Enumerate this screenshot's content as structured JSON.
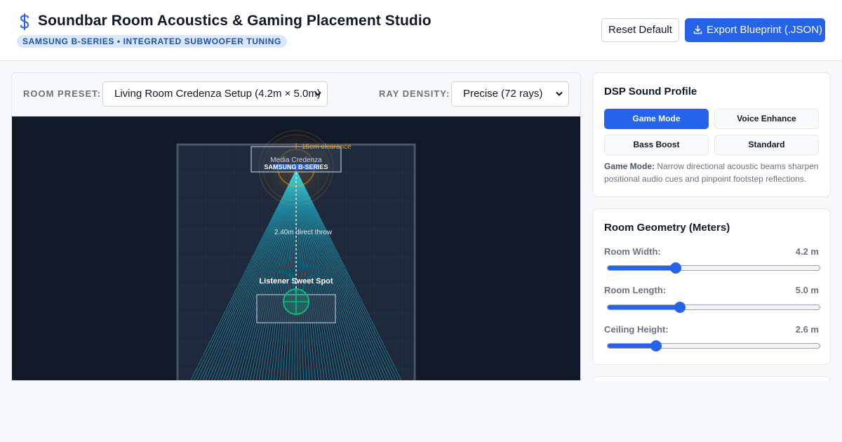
{
  "header": {
    "title": "Soundbar Room Acoustics & Gaming Placement Studio",
    "subtitle": "SAMSUNG B-SERIES • INTEGRATED SUBWOOFER TUNING",
    "logo_icon": "dollar-sign-icon",
    "reset_label": "Reset Default",
    "export_label": "Export Blueprint (.JSON)",
    "export_icon": "download-icon"
  },
  "toolbar": {
    "room_preset_label": "ROOM PRESET:",
    "room_preset_value": "Living Room Credenza Setup (4.2m × 5.0m)",
    "ray_density_label": "RAY DENSITY:",
    "ray_density_value": "Precise (72 rays)"
  },
  "canvas": {
    "clearance_label": "15cm clearance",
    "credenza_label": "Media Credenza",
    "soundbar_label": "SAMSUNG B-SERIES",
    "throw_label": "2.40m direct throw",
    "listener_label": "Listener Sweet Spot",
    "ray_count": 72,
    "colors": {
      "background": "#111827",
      "rays": "#22d3ee",
      "listener": "#10b981",
      "clearance": "#f59e0b",
      "soundbar": "#2563eb"
    }
  },
  "dsp": {
    "title": "DSP Sound Profile",
    "modes": [
      {
        "label": "Game Mode",
        "active": true
      },
      {
        "label": "Voice Enhance",
        "active": false
      },
      {
        "label": "Bass Boost",
        "active": false
      },
      {
        "label": "Standard",
        "active": false
      }
    ],
    "description_bold": "Game Mode:",
    "description_text": " Narrow directional acoustic beams sharpen positional audio cues and pinpoint footstep reflections."
  },
  "geometry": {
    "title": "Room Geometry (Meters)",
    "sliders": [
      {
        "label": "Room Width:",
        "value": "4.2 m",
        "fraction": 0.32
      },
      {
        "label": "Room Length:",
        "value": "5.0 m",
        "fraction": 0.34
      },
      {
        "label": "Ceiling Height:",
        "value": "2.6 m",
        "fraction": 0.23
      }
    ]
  },
  "accent_color": "#2563eb"
}
